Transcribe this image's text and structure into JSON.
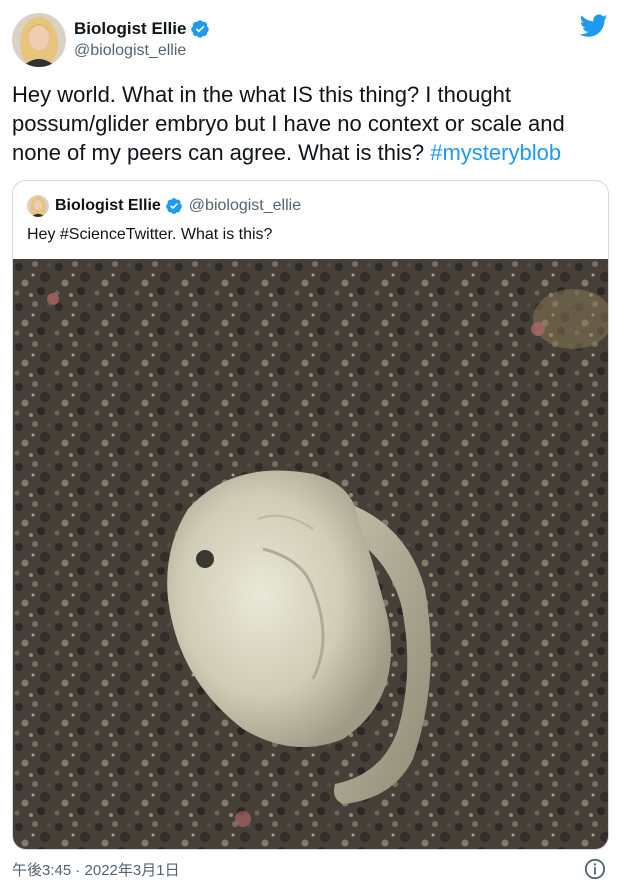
{
  "author": {
    "display_name": "Biologist Ellie",
    "handle": "@biologist_ellie",
    "verified_icon": "verified-badge-icon",
    "platform_icon": "twitter-bird-icon"
  },
  "tweet": {
    "text_main": "Hey world. What in the what IS this thing? I thought possum/glider embryo but I have no context or scale and none of my peers can agree. What is this? ",
    "hashtag": "#mysteryblob"
  },
  "quoted_tweet": {
    "display_name": "Biologist Ellie",
    "handle": "@biologist_ellie",
    "text": "Hey #ScienceTwitter. What is this?"
  },
  "footer": {
    "timestamp": "午後3:45 · 2022年3月1日",
    "info_icon": "info-icon"
  },
  "colors": {
    "accent": "#1d9bf0",
    "text": "#0f1419",
    "muted": "#536471",
    "border": "#cfd9de"
  }
}
